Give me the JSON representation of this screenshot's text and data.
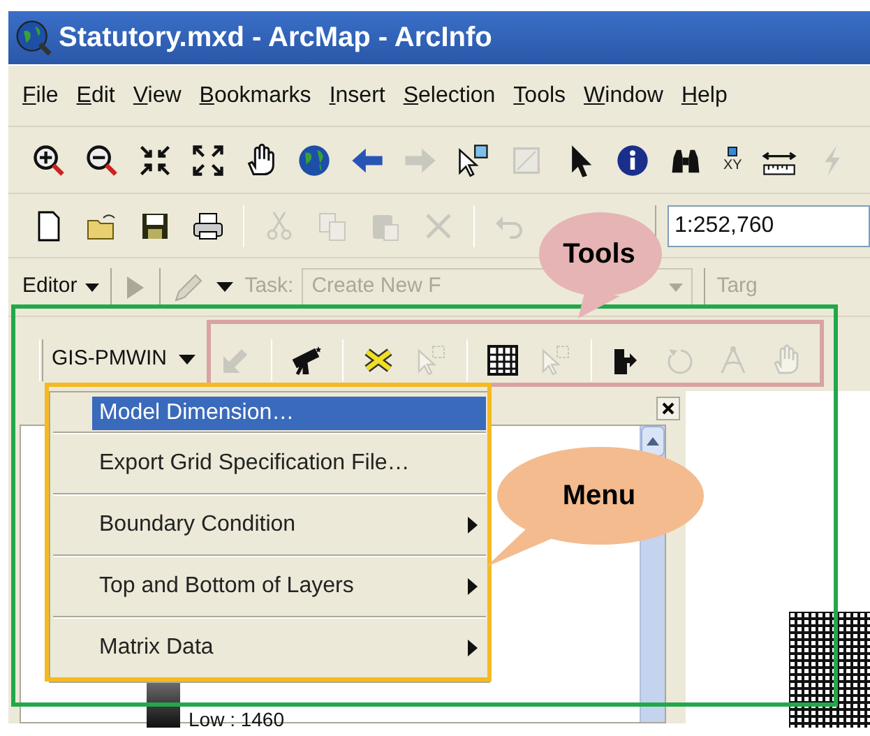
{
  "window": {
    "title": "Statutory.mxd - ArcMap - ArcInfo"
  },
  "menu_bar": [
    "File",
    "Edit",
    "View",
    "Bookmarks",
    "Insert",
    "Selection",
    "Tools",
    "Window",
    "Help"
  ],
  "tools_toolbar": [
    {
      "kind": "zoom-in",
      "disabled": false
    },
    {
      "kind": "zoom-out",
      "disabled": false
    },
    {
      "kind": "shrink",
      "disabled": false
    },
    {
      "kind": "expand",
      "disabled": false
    },
    {
      "kind": "hand",
      "disabled": false
    },
    {
      "kind": "globe",
      "disabled": false
    },
    {
      "kind": "back",
      "disabled": false
    },
    {
      "kind": "forward",
      "disabled": true
    },
    {
      "kind": "select",
      "disabled": false
    },
    {
      "kind": "clear",
      "disabled": true
    },
    {
      "kind": "pointer",
      "disabled": false
    },
    {
      "kind": "info",
      "disabled": false
    },
    {
      "kind": "binoculars",
      "disabled": false
    },
    {
      "kind": "xy",
      "label": "XY",
      "disabled": false
    },
    {
      "kind": "ruler",
      "disabled": false
    },
    {
      "kind": "lightning",
      "disabled": true
    }
  ],
  "standard_toolbar": {
    "tools": [
      {
        "kind": "new",
        "disabled": false
      },
      {
        "kind": "open",
        "disabled": false
      },
      {
        "kind": "save",
        "disabled": false
      },
      {
        "kind": "print",
        "disabled": false
      },
      {
        "kind": "separator"
      },
      {
        "kind": "cut",
        "disabled": true
      },
      {
        "kind": "copy",
        "disabled": true
      },
      {
        "kind": "paste",
        "disabled": true
      },
      {
        "kind": "delete",
        "disabled": true
      },
      {
        "kind": "separator"
      },
      {
        "kind": "undo",
        "disabled": true
      }
    ],
    "scale": "1:252,760"
  },
  "editor_toolbar": {
    "editor": "Editor",
    "task_label": "Task:",
    "task": "Create New F",
    "target_label": "Targ"
  },
  "gis_toolbar": {
    "dropdown": "GIS-PMWIN",
    "tools": [
      {
        "kind": "arrow-sw",
        "disabled": true
      },
      {
        "kind": "separator"
      },
      {
        "kind": "telescope",
        "disabled": false
      },
      {
        "kind": "separator"
      },
      {
        "kind": "x-mark",
        "disabled": false
      },
      {
        "kind": "select",
        "disabled": true
      },
      {
        "kind": "separator"
      },
      {
        "kind": "grid",
        "disabled": false
      },
      {
        "kind": "select",
        "disabled": true
      },
      {
        "kind": "separator"
      },
      {
        "kind": "blocks",
        "disabled": false
      },
      {
        "kind": "rotate",
        "disabled": true
      },
      {
        "kind": "compass",
        "disabled": true
      },
      {
        "kind": "hand",
        "disabled": true
      }
    ]
  },
  "menu": [
    {
      "label": "Model Dimension…",
      "selected": true,
      "submenu": false
    },
    {
      "label": "Export Grid Specification File…",
      "selected": false,
      "submenu": false
    },
    {
      "label": "Boundary Condition",
      "selected": false,
      "submenu": true
    },
    {
      "label": "Top and Bottom of Layers",
      "selected": false,
      "submenu": true
    },
    {
      "label": "Matrix Data",
      "selected": false,
      "submenu": true
    }
  ],
  "legend": {
    "low": "Low : 1460"
  },
  "callouts": [
    {
      "text": "Tools",
      "color": "#e6b4b4"
    },
    {
      "text": "Menu",
      "color": "#f3bb8e"
    }
  ]
}
